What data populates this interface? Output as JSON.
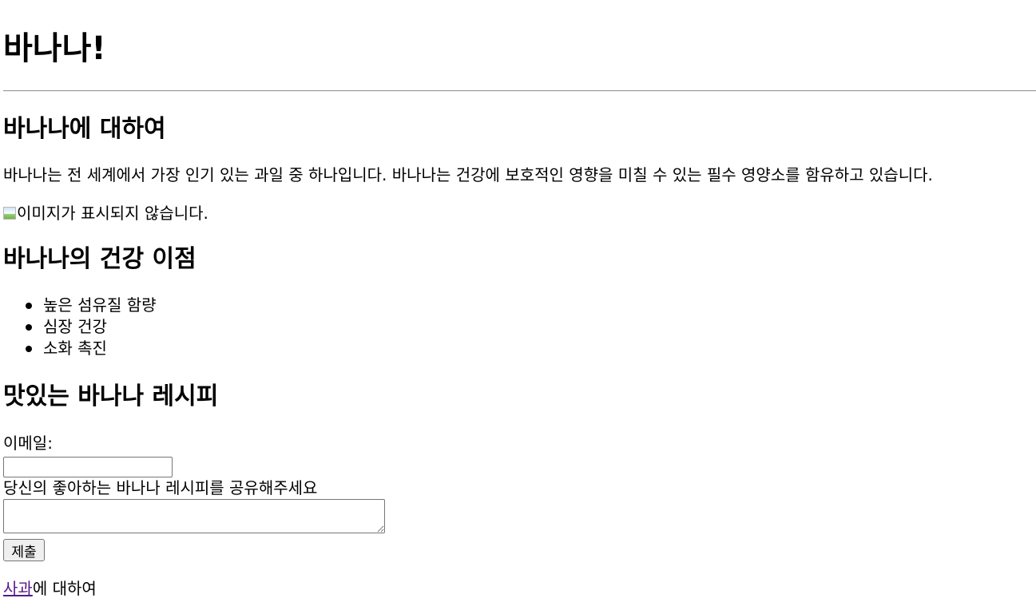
{
  "header": {
    "title": "바나나!"
  },
  "about": {
    "heading": "바나나에 대하여",
    "description": "바나나는 전 세계에서 가장 인기 있는 과일 중 하나입니다. 바나나는 건강에 보호적인 영향을 미칠 수 있는 필수 영양소를 함유하고 있습니다.",
    "image_alt": "이미지가 표시되지 않습니다."
  },
  "health": {
    "heading": "바나나의 건강 이점",
    "items": [
      {
        "label": "높은 섬유질 함량"
      },
      {
        "label": "심장 건강"
      },
      {
        "label": "소화 촉진"
      }
    ]
  },
  "recipe_form": {
    "heading": "맛있는 바나나 레시피",
    "email_label": "이메일:",
    "email_value": "",
    "recipe_label": "당신의 좋아하는 바나나 레시피를 공유해주세요",
    "recipe_value": "",
    "submit_label": "제출"
  },
  "footer": {
    "link_label": "사과",
    "link_suffix": "에 대하여",
    "link_color": "#551a8b"
  }
}
